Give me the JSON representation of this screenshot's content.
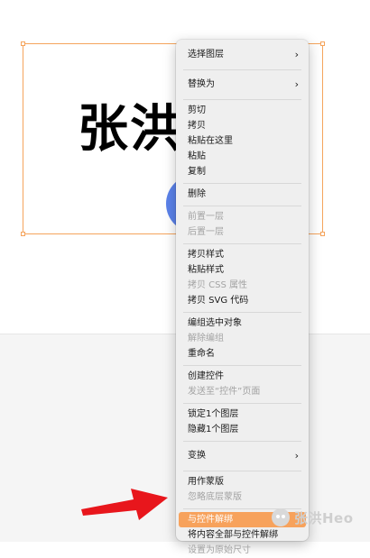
{
  "canvas": {
    "big_text": "张洪"
  },
  "context_menu": {
    "groups": [
      [
        {
          "label": "选择图层",
          "submenu": true,
          "enabled": true
        }
      ],
      [
        {
          "label": "替换为",
          "submenu": true,
          "enabled": true
        }
      ],
      [
        {
          "label": "剪切",
          "enabled": true
        },
        {
          "label": "拷贝",
          "enabled": true
        },
        {
          "label": "粘贴在这里",
          "enabled": true
        },
        {
          "label": "粘贴",
          "enabled": true
        },
        {
          "label": "复制",
          "enabled": true
        }
      ],
      [
        {
          "label": "删除",
          "enabled": true
        }
      ],
      [
        {
          "label": "前置一层",
          "enabled": false
        },
        {
          "label": "后置一层",
          "enabled": false
        }
      ],
      [
        {
          "label": "拷贝样式",
          "enabled": true
        },
        {
          "label": "粘贴样式",
          "enabled": true
        },
        {
          "label": "拷贝 CSS 属性",
          "enabled": false
        },
        {
          "label": "拷贝 SVG 代码",
          "enabled": true
        }
      ],
      [
        {
          "label": "编组选中对象",
          "enabled": true
        },
        {
          "label": "解除编组",
          "enabled": false
        },
        {
          "label": "重命名",
          "enabled": true
        }
      ],
      [
        {
          "label": "创建控件",
          "enabled": true
        },
        {
          "label": "发送至“控件”页面",
          "enabled": false
        }
      ],
      [
        {
          "label": "锁定1个图层",
          "enabled": true
        },
        {
          "label": "隐藏1个图层",
          "enabled": true
        }
      ],
      [
        {
          "label": "变换",
          "submenu": true,
          "enabled": true
        }
      ],
      [
        {
          "label": "用作蒙版",
          "enabled": true
        },
        {
          "label": "忽略底层蒙版",
          "enabled": false
        }
      ],
      [
        {
          "label": "与控件解绑",
          "enabled": true,
          "highlighted": true
        },
        {
          "label": "将内容全部与控件解绑",
          "enabled": true
        },
        {
          "label": "设置为原始尺寸",
          "enabled": false
        }
      ]
    ]
  },
  "watermark": {
    "text": "张洪Heo"
  },
  "colors": {
    "selection": "#f5a45c",
    "highlight": "#f7a25c",
    "arrow": "#e8161c",
    "circle": "#5b82ea"
  },
  "icons": {
    "submenu": "chevron-right-icon",
    "arrow": "red-arrow-icon",
    "watermark_logo": "smiley-logo-icon"
  }
}
